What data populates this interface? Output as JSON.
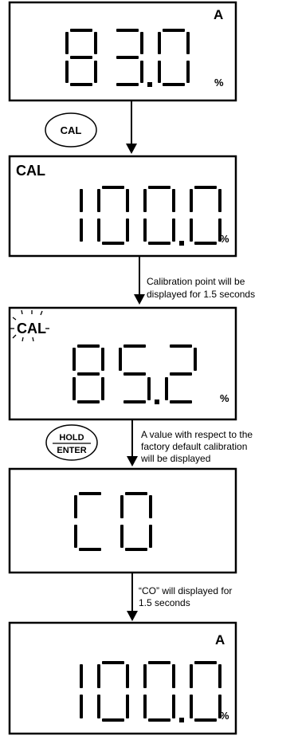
{
  "screens": [
    {
      "top_label": "",
      "corner_label": "A",
      "digits": "83.0",
      "unit": "%"
    },
    {
      "top_label": "CAL",
      "corner_label": "",
      "digits": "100.0",
      "unit": "%"
    },
    {
      "top_label": "CAL",
      "corner_label": "",
      "digits": "85.2",
      "unit": "%",
      "top_label_blinking": true
    },
    {
      "top_label": "",
      "corner_label": "",
      "digits": "C0",
      "unit": ""
    },
    {
      "top_label": "",
      "corner_label": "A",
      "digits": "100.0",
      "unit": "%"
    }
  ],
  "buttons": {
    "cal": {
      "label": "CAL"
    },
    "hold_enter": {
      "line1": "HOLD",
      "line2": "ENTER"
    }
  },
  "steps": [
    {
      "note_lines": []
    },
    {
      "note_lines": [
        "Calibration point  will be",
        "displayed for 1.5 seconds"
      ]
    },
    {
      "note_lines": [
        "A value with respect to the",
        "factory default calibration",
        "will be displayed"
      ]
    },
    {
      "note_lines": [
        "“CO” will displayed for",
        "1.5 seconds"
      ]
    }
  ]
}
